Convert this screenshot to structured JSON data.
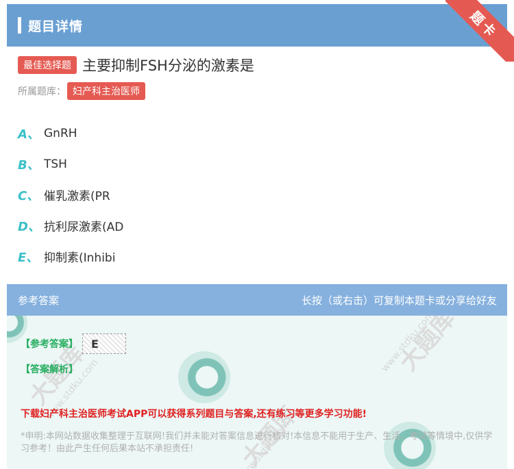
{
  "header": {
    "title": "题目详情"
  },
  "ribbon": {
    "label": "题卡"
  },
  "question": {
    "type_tag": "最佳选择题",
    "text": "主要抑制FSH分泌的激素是"
  },
  "bank": {
    "label": "所属题库：",
    "name": "妇产科主治医师"
  },
  "options": [
    {
      "letter": "A、",
      "text": "GnRH"
    },
    {
      "letter": "B、",
      "text": "TSH"
    },
    {
      "letter": "C、",
      "text": "催乳激素(PR"
    },
    {
      "letter": "D、",
      "text": "抗利尿激素(AD"
    },
    {
      "letter": "E、",
      "text": "抑制素(Inhibi"
    }
  ],
  "answer_section": {
    "title": "参考答案",
    "hint": "长按（或右击）可复制本题卡或分享给好友",
    "answer_label": "【参考答案】",
    "answer_value": "E",
    "analysis_label": "【答案解析】",
    "promo": "下载妇产科主治医师考试APP可以获得系列题目与答案,还有练习等更多学习功能!",
    "disclaimer": "*申明:本网站数据收集整理于互联网!我们并未能对答案信息进行核对!本信息不能用于生产、生活、考试等情境中,仅供学习参考！由此产生任何后果本站不承担责任!"
  },
  "watermark": {
    "text": "大题库",
    "url": "www.stdku.com"
  },
  "colors": {
    "header": "#6a9fd2",
    "tag": "#e55a52",
    "option_letter": "#3ac0c8",
    "answer_green": "#27ae60",
    "promo_red": "#e02020"
  }
}
